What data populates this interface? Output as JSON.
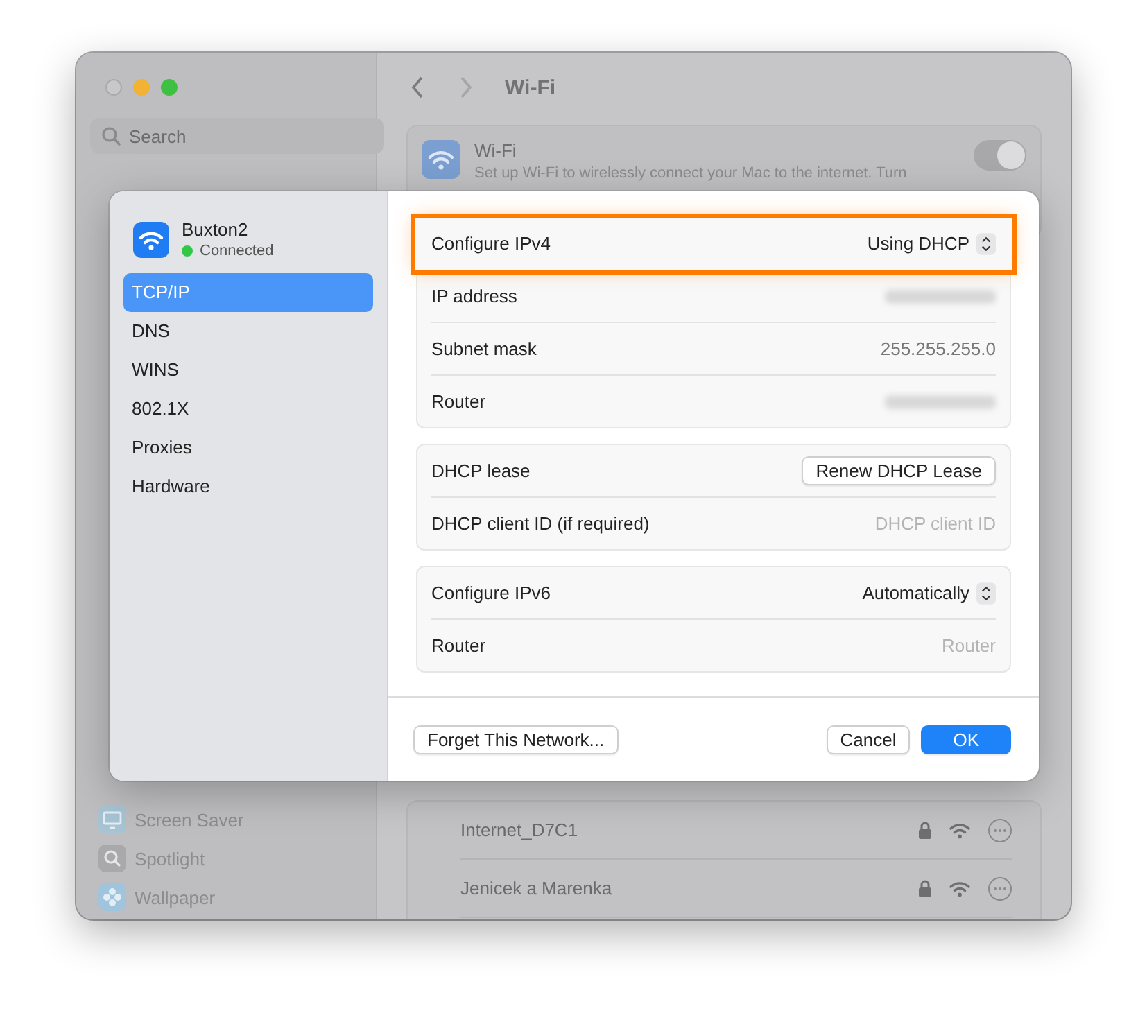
{
  "background_window": {
    "title": "Wi-Fi",
    "search": {
      "placeholder": "Search"
    },
    "sidebar_items": [
      {
        "label": "Screen Saver",
        "kind": "screen"
      },
      {
        "label": "Spotlight",
        "kind": "search"
      },
      {
        "label": "Wallpaper",
        "kind": "flower"
      }
    ],
    "wifi": {
      "title": "Wi-Fi",
      "description": "Set up Wi-Fi to wirelessly connect your Mac to the internet. Turn",
      "on": true
    },
    "networks": [
      {
        "name": "Internet_D7C1",
        "locked": true
      },
      {
        "name": "Jenicek a Marenka",
        "locked": true
      }
    ]
  },
  "dialog": {
    "network": {
      "name": "Buxton2",
      "status": "Connected",
      "connected": true
    },
    "tabs": [
      {
        "label": "TCP/IP",
        "selected": true
      },
      {
        "label": "DNS",
        "selected": false
      },
      {
        "label": "WINS",
        "selected": false
      },
      {
        "label": "802.1X",
        "selected": false
      },
      {
        "label": "Proxies",
        "selected": false
      },
      {
        "label": "Hardware",
        "selected": false
      }
    ],
    "sections": [
      [
        {
          "label": "Configure IPv4",
          "kind": "popup",
          "value": "Using DHCP",
          "highlighted": true
        },
        {
          "label": "IP address",
          "kind": "blurred",
          "highlighted": false
        },
        {
          "label": "Subnet mask",
          "kind": "value",
          "value": "255.255.255.0",
          "highlighted": false
        },
        {
          "label": "Router",
          "kind": "blurred",
          "highlighted": false
        }
      ],
      [
        {
          "label": "DHCP lease",
          "kind": "button",
          "value": "Renew DHCP Lease",
          "highlighted": false
        },
        {
          "label": "DHCP client ID (if required)",
          "kind": "field",
          "placeholder": "DHCP client ID",
          "highlighted": false
        }
      ],
      [
        {
          "label": "Configure IPv6",
          "kind": "popup",
          "value": "Automatically",
          "highlighted": false
        },
        {
          "label": "Router",
          "kind": "field",
          "placeholder": "Router",
          "highlighted": false
        }
      ]
    ],
    "footer": {
      "left_button": "Forget This Network...",
      "cancel_button": "Cancel",
      "ok_button": "OK"
    }
  }
}
